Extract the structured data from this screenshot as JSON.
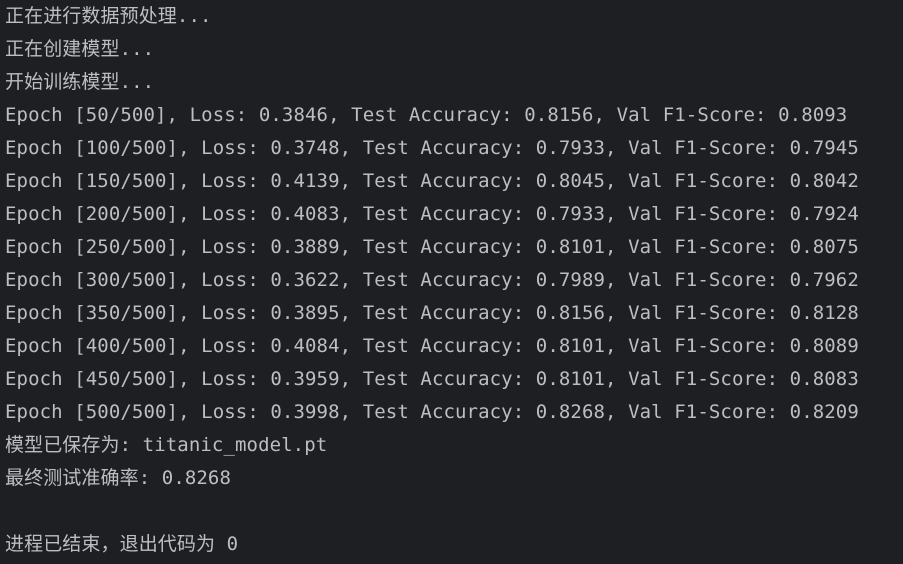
{
  "console": {
    "lines": [
      "正在进行数据预处理...",
      "正在创建模型...",
      "开始训练模型...",
      "Epoch [50/500], Loss: 0.3846, Test Accuracy: 0.8156, Val F1-Score: 0.8093",
      "Epoch [100/500], Loss: 0.3748, Test Accuracy: 0.7933, Val F1-Score: 0.7945",
      "Epoch [150/500], Loss: 0.4139, Test Accuracy: 0.8045, Val F1-Score: 0.8042",
      "Epoch [200/500], Loss: 0.4083, Test Accuracy: 0.7933, Val F1-Score: 0.7924",
      "Epoch [250/500], Loss: 0.3889, Test Accuracy: 0.8101, Val F1-Score: 0.8075",
      "Epoch [300/500], Loss: 0.3622, Test Accuracy: 0.7989, Val F1-Score: 0.7962",
      "Epoch [350/500], Loss: 0.3895, Test Accuracy: 0.8156, Val F1-Score: 0.8128",
      "Epoch [400/500], Loss: 0.4084, Test Accuracy: 0.8101, Val F1-Score: 0.8089",
      "Epoch [450/500], Loss: 0.3959, Test Accuracy: 0.8101, Val F1-Score: 0.8083",
      "Epoch [500/500], Loss: 0.3998, Test Accuracy: 0.8268, Val F1-Score: 0.8209",
      "模型已保存为: titanic_model.pt",
      "最终测试准确率: 0.8268",
      "",
      "进程已结束，退出代码为 0"
    ]
  },
  "colors": {
    "background": "#1e1f22",
    "text": "#bcbec4"
  }
}
